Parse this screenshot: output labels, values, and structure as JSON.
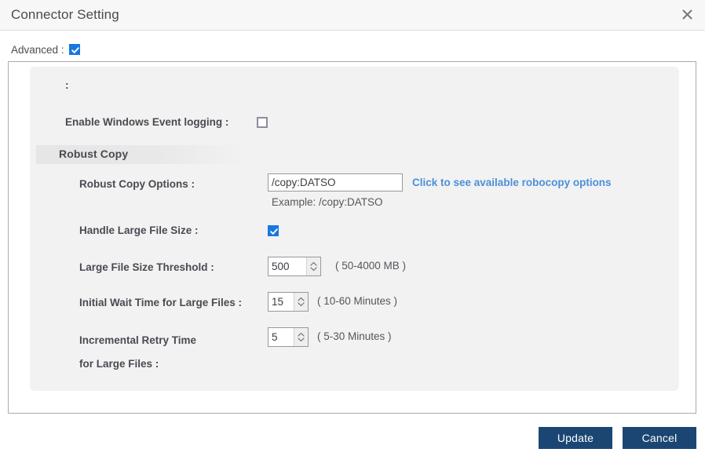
{
  "titlebar": {
    "title": "Connector Setting",
    "close_icon": "close-x-icon"
  },
  "advanced": {
    "label": "Advanced :",
    "checked": true
  },
  "panel": {
    "orphan_colon": ":",
    "event_logging": {
      "label": "Enable Windows Event logging :",
      "checked": false
    },
    "section": {
      "title": "Robust Copy"
    },
    "robust_copy_options": {
      "label": "Robust Copy Options :",
      "value": "/copy:DATSO",
      "placeholder": "",
      "example": "Example: /copy:DATSO",
      "link": "Click to see available robocopy options",
      "link_color": "#4a90d9"
    },
    "handle_large_file_size": {
      "label": "Handle Large File Size :",
      "checked": true
    },
    "large_file_size_threshold": {
      "label": "Large File Size Threshold :",
      "value": "500",
      "range": "( 50-4000 MB )"
    },
    "initial_wait_time": {
      "label": "Initial Wait Time for Large Files :",
      "value": "15",
      "range": "( 10-60 Minutes )"
    },
    "incremental_retry_time": {
      "label": "Incremental Retry Time for Large Files :",
      "value": "5",
      "range": "( 5-30 Minutes )"
    }
  },
  "footer": {
    "update_label": "Update",
    "cancel_label": "Cancel",
    "button_color": "#1b4674"
  }
}
